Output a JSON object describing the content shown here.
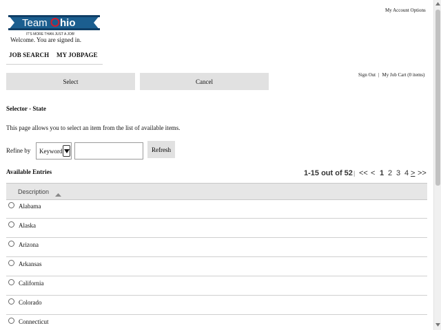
{
  "header": {
    "logo_text": "TeamOhio",
    "logo_tagline": "IT'S MORE THAN JUST A JOB!",
    "welcome": "Welcome. You are signed in.",
    "account_options": "My Account Options"
  },
  "nav": {
    "job_search": "JOB SEARCH",
    "my_jobpage": "MY JOBPAGE"
  },
  "actions": {
    "select": "Select",
    "cancel": "Cancel"
  },
  "user_links": {
    "sign_out": "Sign Out",
    "separator": "|",
    "job_cart": "My Job Cart (0 items)"
  },
  "page": {
    "title": "Selector - State",
    "description": "This page allows you to select an item from the list of available items."
  },
  "filter": {
    "label": "Refine by",
    "field_selected": "Keyword",
    "search_value": "",
    "refresh_label": "Refresh"
  },
  "list": {
    "heading": "Available Entries",
    "column_header": "Description",
    "sort_direction": "ascending",
    "items": [
      "Alabama",
      "Alaska",
      "Arizona",
      "Arkansas",
      "California",
      "Colorado",
      "Connecticut"
    ]
  },
  "pagination": {
    "count_text": "1-15 out of 52",
    "divider": "|",
    "first": "<<",
    "prev": "<",
    "pages": [
      "1",
      "2",
      "3",
      "4"
    ],
    "current_page": "1",
    "next": ">",
    "last": ">>"
  },
  "colors": {
    "logo_blue": "#1b5e8f",
    "logo_dark": "#0f3e66",
    "button_gray": "#e1e1e1",
    "header_gray": "#e6e6e6"
  }
}
